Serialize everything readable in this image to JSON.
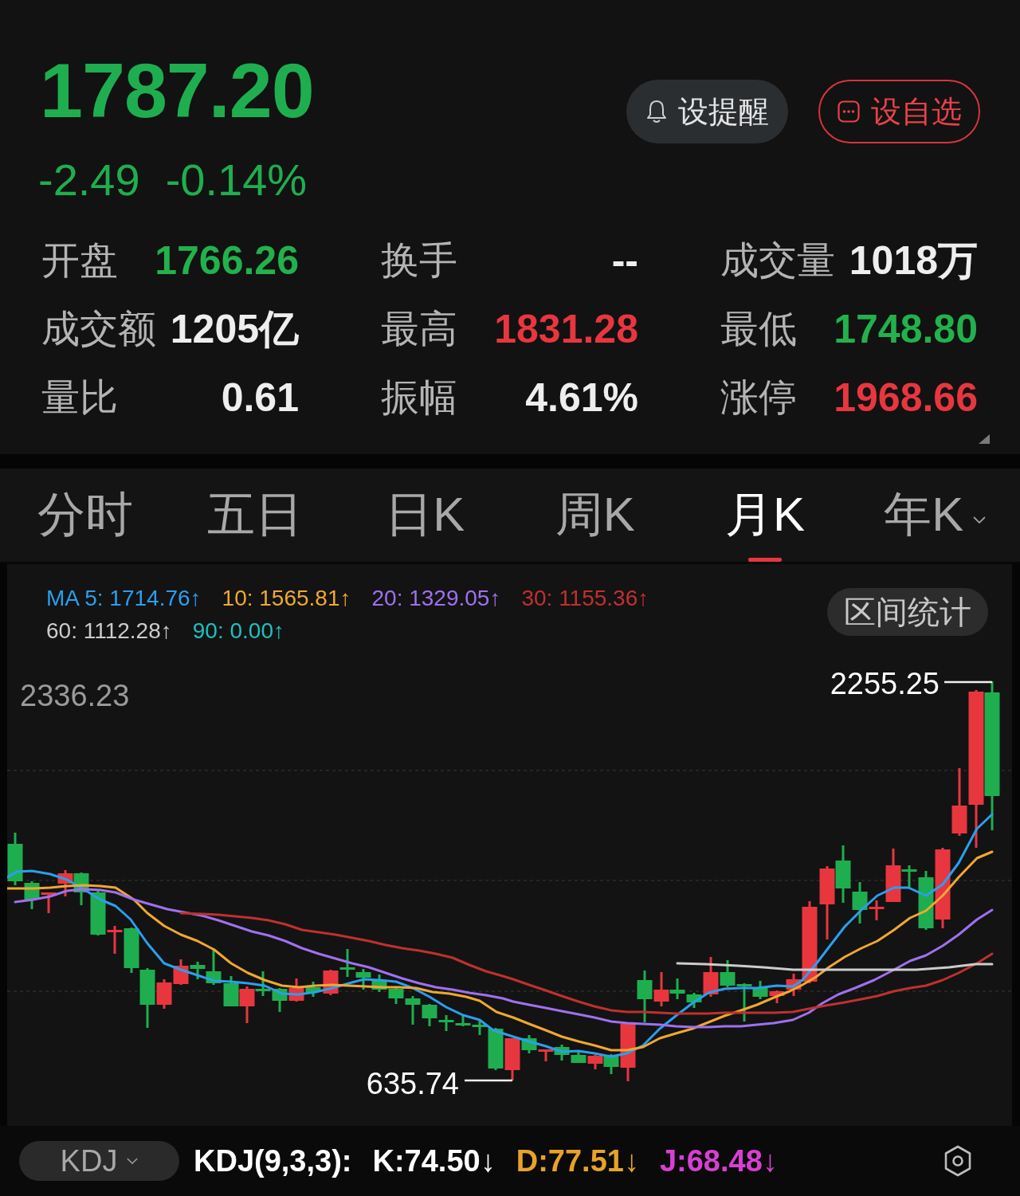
{
  "quote": {
    "price": "1787.20",
    "change": "-2.49",
    "change_percent": "-0.14%",
    "down": true
  },
  "actions": [
    {
      "kind": "alert",
      "label": "设提醒"
    },
    {
      "kind": "watchlist",
      "label": "设自选"
    }
  ],
  "stats": [
    {
      "label": "开盘",
      "value": "1766.26",
      "color": "#22b14c"
    },
    {
      "label": "换手",
      "value": "--",
      "color": "#eeeeee"
    },
    {
      "label": "成交量",
      "value": "1018万",
      "color": "#eeeeee"
    },
    {
      "label": "成交额",
      "value": "1205亿",
      "color": "#eeeeee"
    },
    {
      "label": "最高",
      "value": "1831.28",
      "color": "#e8363f"
    },
    {
      "label": "最低",
      "value": "1748.80",
      "color": "#22b14c"
    },
    {
      "label": "量比",
      "value": "0.61",
      "color": "#eeeeee"
    },
    {
      "label": "振幅",
      "value": "4.61%",
      "color": "#eeeeee"
    },
    {
      "label": "涨停",
      "value": "1968.66",
      "color": "#e8363f"
    }
  ],
  "period_tabs": [
    {
      "label": "分时",
      "selected": false,
      "menu": false
    },
    {
      "label": "五日",
      "selected": false,
      "menu": false
    },
    {
      "label": "日K",
      "selected": false,
      "menu": false
    },
    {
      "label": "周K",
      "selected": false,
      "menu": false
    },
    {
      "label": "月K",
      "selected": true,
      "menu": false
    },
    {
      "label": "年K",
      "selected": false,
      "menu": true
    }
  ],
  "chart": {
    "legend_rows": [
      [
        {
          "text": "MA 5: 1714.76↑",
          "color": "#2a9ff0"
        },
        {
          "text": "10: 1565.81↑",
          "color": "#f0a830"
        },
        {
          "text": "20: 1329.05↑",
          "color": "#a070f0"
        },
        {
          "text": "30: 1155.36↑",
          "color": "#c0302f"
        }
      ],
      [
        {
          "text": "60: 1112.28↑",
          "color": "#cccccc"
        },
        {
          "text": "90: 0.00↑",
          "color": "#20c0c0"
        }
      ]
    ],
    "range_stats_button": "区间统计",
    "axis_max": "2336.23",
    "high_label": "2255.25",
    "low_label": "635.74"
  },
  "indicator_bar": {
    "selector": "KDJ",
    "readings": [
      {
        "text": "KDJ(9,3,3):",
        "color": "#ffffff"
      },
      {
        "text": "K:74.50↓",
        "color": "#ffffff"
      },
      {
        "text": "D:77.51↓",
        "color": "#e8a227"
      },
      {
        "text": "J:68.48↓",
        "color": "#d93fd3"
      }
    ]
  }
}
